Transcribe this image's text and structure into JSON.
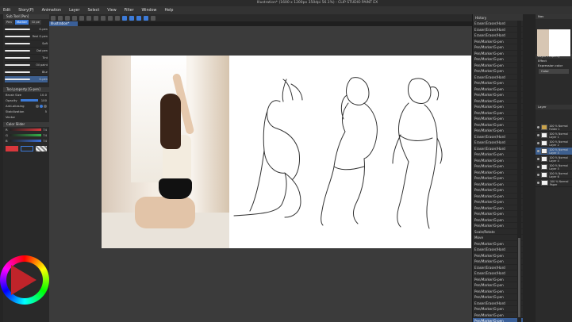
{
  "window": {
    "title": "Illustration* (1600 x 1200px 350dpi 56.1%) - CLIP STUDIO PAINT EX"
  },
  "menu": [
    "Edit",
    "Story(P)",
    "Animation",
    "Layer",
    "Select",
    "View",
    "Filter",
    "Window",
    "Help"
  ],
  "document_tab": "Illustration*",
  "left_panel": {
    "subtool_header": "Sub Tool [Pen]",
    "tabs": [
      "Pen",
      "Marker",
      "Gi pe"
    ],
    "brushes": [
      {
        "name": "G-pen"
      },
      {
        "name": "Real G-pen"
      },
      {
        "name": "Soft"
      },
      {
        "name": "Dot pen"
      },
      {
        "name": "Tint"
      },
      {
        "name": "Oil paint"
      },
      {
        "name": "Blur"
      },
      {
        "name": "G-pen"
      }
    ],
    "tool_property_header": "Tool property [G-pen]",
    "brush_size_label": "Brush Size",
    "brush_size_value": "10.0",
    "opacity_label": "Opacity",
    "opacity_value": "100",
    "anti_alias_label": "Anti-aliasing",
    "stabilization_label": "Stabilization",
    "stabilization_value": "5",
    "vector_label": "Vector",
    "color_slider_header": "Color Slider",
    "rgb": [
      {
        "channel": "R",
        "value": "74",
        "color": "#d8373c"
      },
      {
        "channel": "G",
        "value": "74",
        "color": "#34b24a"
      },
      {
        "channel": "B",
        "value": "74",
        "color": "#3b6fd8"
      }
    ],
    "main_color": "#d8373c",
    "sub_color": "#2a2a2a"
  },
  "history": {
    "header": "History",
    "items": [
      "Eraser/Eraser/Hard",
      "Eraser/Eraser/Hard",
      "Eraser/Eraser/Hard",
      "Pen/Marker/G-pen",
      "Pen/Marker/G-pen",
      "Pen/Marker/G-pen",
      "Pen/Marker/G-pen",
      "Pen/Marker/G-pen",
      "Pen/Marker/G-pen",
      "Eraser/Eraser/Hard",
      "Pen/Marker/G-pen",
      "Pen/Marker/G-pen",
      "Pen/Marker/G-pen",
      "Pen/Marker/G-pen",
      "Pen/Marker/G-pen",
      "Pen/Marker/G-pen",
      "Pen/Marker/G-pen",
      "Pen/Marker/G-pen",
      "Pen/Marker/G-pen",
      "Eraser/Eraser/Hard",
      "Eraser/Eraser/Hard",
      "Eraser/Eraser/Hard",
      "Pen/Marker/G-pen",
      "Pen/Marker/G-pen",
      "Pen/Marker/G-pen",
      "Pen/Marker/G-pen",
      "Pen/Marker/G-pen",
      "Pen/Marker/G-pen",
      "Pen/Marker/G-pen",
      "Pen/Marker/G-pen",
      "Pen/Marker/G-pen",
      "Pen/Marker/G-pen",
      "Pen/Marker/G-pen",
      "Pen/Marker/G-pen",
      "Pen/Marker/G-pen",
      "Scale/Rotate",
      "Move",
      "Pen/Marker/G-pen",
      "Eraser/Eraser/Hard",
      "Pen/Marker/G-pen",
      "Pen/Marker/G-pen",
      "Eraser/Eraser/Hard",
      "Eraser/Eraser/Hard",
      "Pen/Marker/G-pen",
      "Pen/Marker/G-pen",
      "Pen/Marker/G-pen",
      "Pen/Marker/G-pen",
      "Eraser/Eraser/Hard",
      "Pen/Marker/G-pen",
      "Pen/Marker/G-pen",
      "Pen/Marker/G-pen"
    ]
  },
  "right_panel": {
    "navigator_header": "Nav",
    "layer_property_header": "Layer Property",
    "effect_label": "Effect",
    "expression_label": "Expression color",
    "expression_value": "Color",
    "layer_header": "Layer",
    "layers": [
      {
        "name": "100 % Normal Folder 1"
      },
      {
        "name": "100 % Normal Layer 1"
      },
      {
        "name": "100 % Normal Layer 2"
      },
      {
        "name": "100 % Normal Layer 3"
      },
      {
        "name": "100 % Normal Layer 4"
      },
      {
        "name": "100 % Normal Layer 5"
      },
      {
        "name": "100 % Normal Layer 6"
      },
      {
        "name": "100 % Normal Paper"
      }
    ]
  }
}
